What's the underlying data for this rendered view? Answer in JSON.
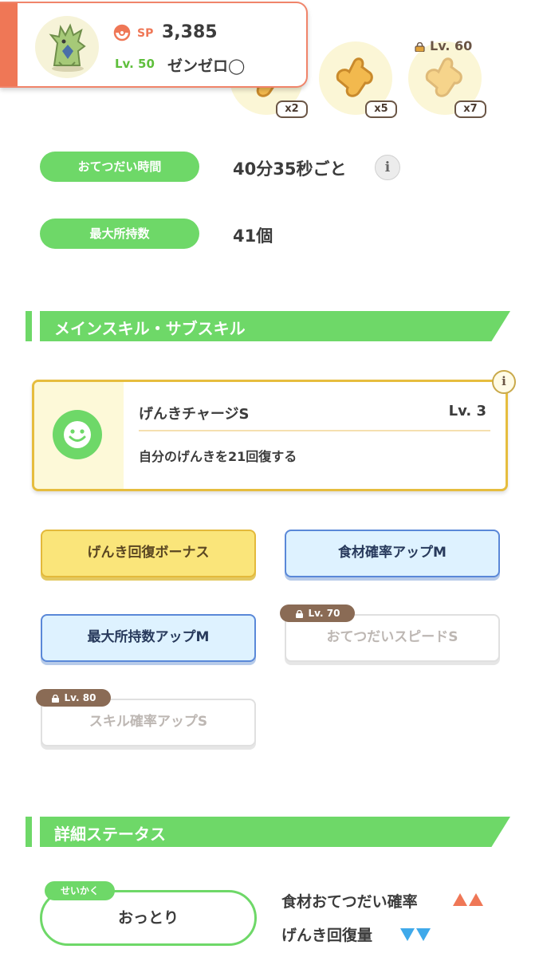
{
  "pokemon": {
    "sp_label": "SP",
    "sp_value": "3,385",
    "level": "Lv. 50",
    "name": "ゼンゼロ◯"
  },
  "ingredients": [
    {
      "icon": "ginger-icon",
      "count": "x2"
    },
    {
      "icon": "ginger-icon",
      "count": "x5"
    },
    {
      "icon": "ginger-icon",
      "count": "x7",
      "lock_level": "Lv. 60"
    }
  ],
  "help_time": {
    "label": "おてつだい時間",
    "value": "40分35秒ごと"
  },
  "max_carry": {
    "label": "最大所持数",
    "value": "41個"
  },
  "sections": {
    "skills_title": "メインスキル・サブスキル",
    "status_title": "詳細ステータス"
  },
  "main_skill": {
    "name": "げんきチャージS",
    "level": "Lv. 3",
    "description": "自分のげんきを21回復する",
    "icon": "smile-icon"
  },
  "sub_skills": [
    {
      "label": "げんき回復ボーナス",
      "style": "gold"
    },
    {
      "label": "食材確率アップM",
      "style": "blue"
    },
    {
      "label": "最大所持数アップM",
      "style": "blue"
    },
    {
      "label": "おてつだいスピードS",
      "style": "grey",
      "lock_level": "Lv. 70"
    },
    {
      "label": "スキル確率アップS",
      "style": "grey",
      "lock_level": "Lv. 80"
    }
  ],
  "nature": {
    "tag": "せいかく",
    "value": "おっとり"
  },
  "nature_effects": [
    {
      "label": "食材おてつだい確率",
      "direction": "up"
    },
    {
      "label": "げんき回復量",
      "direction": "down"
    }
  ],
  "colors": {
    "accent_green": "#6ed868",
    "accent_orange": "#ef7756",
    "gold": "#e6bd3e",
    "blue": "#5a88d8",
    "down_arrow": "#3fa9ea"
  }
}
